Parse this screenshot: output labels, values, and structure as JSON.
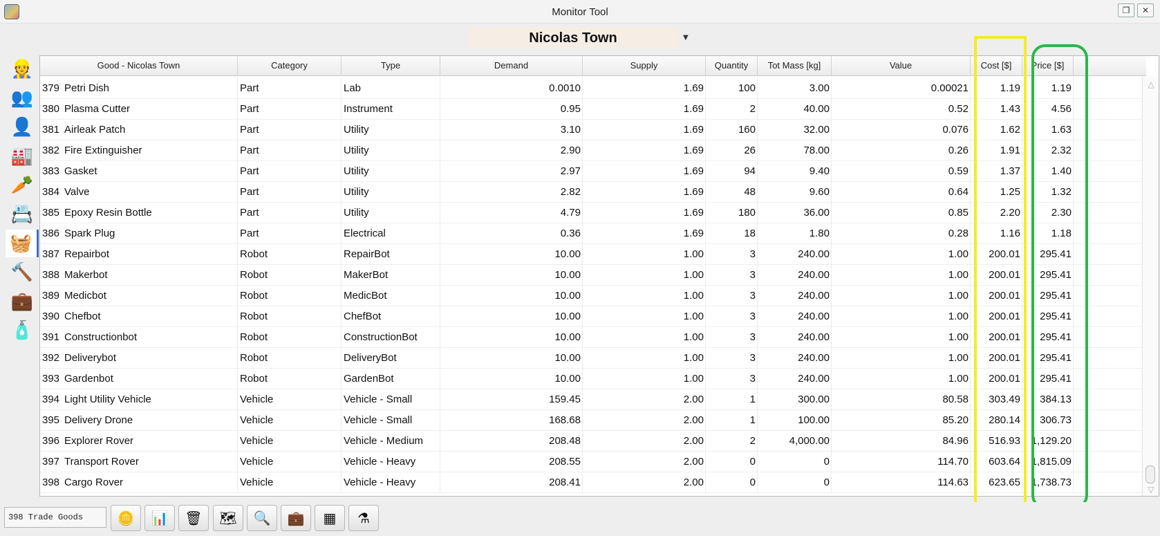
{
  "window": {
    "title": "Monitor Tool",
    "restore_glyph": "❐",
    "close_glyph": "✕"
  },
  "settlement": {
    "name": "Nicolas Town",
    "arrow": "▼"
  },
  "sidebar": {
    "items": [
      {
        "icon": "👷",
        "name": "people-icon",
        "color": "#6b3b14"
      },
      {
        "icon": "👥",
        "name": "crew-icon",
        "color": "#c03030"
      },
      {
        "icon": "👤",
        "name": "person-icon",
        "color": "#8e9aa3"
      },
      {
        "icon": "🏭",
        "name": "factory-icon",
        "color": "#0f7a4a"
      },
      {
        "icon": "🥕",
        "name": "food-icon",
        "color": "#ee6a1a"
      },
      {
        "icon": "📇",
        "name": "resource-icon",
        "color": "#555555"
      },
      {
        "icon": "🧺",
        "name": "trade-basket-icon",
        "color": "#2f9a28"
      },
      {
        "icon": "🔨",
        "name": "construction-icon",
        "color": "#3b7fc0"
      },
      {
        "icon": "💼",
        "name": "mission-briefcase-icon",
        "color": "#a0521d"
      },
      {
        "icon": "🧴",
        "name": "science-icon",
        "color": "#333333"
      }
    ]
  },
  "table": {
    "columns": [
      "Good - Nicolas Town",
      "Category",
      "Type",
      "Demand",
      "Supply",
      "Quantity",
      "Tot Mass [kg]",
      "Value",
      "Cost [$]",
      "Price [$]"
    ],
    "rows": [
      [
        "379",
        "Petri Dish",
        "Part",
        "Lab",
        "0.0010",
        "1.69",
        "100",
        "3.00",
        "0.00021",
        "1.19",
        "1.19"
      ],
      [
        "380",
        "Plasma Cutter",
        "Part",
        "Instrument",
        "0.95",
        "1.69",
        "2",
        "40.00",
        "0.52",
        "1.43",
        "4.56"
      ],
      [
        "381",
        "Airleak Patch",
        "Part",
        "Utility",
        "3.10",
        "1.69",
        "160",
        "32.00",
        "0.076",
        "1.62",
        "1.63"
      ],
      [
        "382",
        "Fire Extinguisher",
        "Part",
        "Utility",
        "2.90",
        "1.69",
        "26",
        "78.00",
        "0.26",
        "1.91",
        "2.32"
      ],
      [
        "383",
        "Gasket",
        "Part",
        "Utility",
        "2.97",
        "1.69",
        "94",
        "9.40",
        "0.59",
        "1.37",
        "1.40"
      ],
      [
        "384",
        "Valve",
        "Part",
        "Utility",
        "2.82",
        "1.69",
        "48",
        "9.60",
        "0.64",
        "1.25",
        "1.32"
      ],
      [
        "385",
        "Epoxy Resin Bottle",
        "Part",
        "Utility",
        "4.79",
        "1.69",
        "180",
        "36.00",
        "0.85",
        "2.20",
        "2.30"
      ],
      [
        "386",
        "Spark Plug",
        "Part",
        "Electrical",
        "0.36",
        "1.69",
        "18",
        "1.80",
        "0.28",
        "1.16",
        "1.18"
      ],
      [
        "387",
        "Repairbot",
        "Robot",
        "RepairBot",
        "10.00",
        "1.00",
        "3",
        "240.00",
        "1.00",
        "200.01",
        "295.41"
      ],
      [
        "388",
        "Makerbot",
        "Robot",
        "MakerBot",
        "10.00",
        "1.00",
        "3",
        "240.00",
        "1.00",
        "200.01",
        "295.41"
      ],
      [
        "389",
        "Medicbot",
        "Robot",
        "MedicBot",
        "10.00",
        "1.00",
        "3",
        "240.00",
        "1.00",
        "200.01",
        "295.41"
      ],
      [
        "390",
        "Chefbot",
        "Robot",
        "ChefBot",
        "10.00",
        "1.00",
        "3",
        "240.00",
        "1.00",
        "200.01",
        "295.41"
      ],
      [
        "391",
        "Constructionbot",
        "Robot",
        "ConstructionBot",
        "10.00",
        "1.00",
        "3",
        "240.00",
        "1.00",
        "200.01",
        "295.41"
      ],
      [
        "392",
        "Deliverybot",
        "Robot",
        "DeliveryBot",
        "10.00",
        "1.00",
        "3",
        "240.00",
        "1.00",
        "200.01",
        "295.41"
      ],
      [
        "393",
        "Gardenbot",
        "Robot",
        "GardenBot",
        "10.00",
        "1.00",
        "3",
        "240.00",
        "1.00",
        "200.01",
        "295.41"
      ],
      [
        "394",
        "Light Utility Vehicle",
        "Vehicle",
        "Vehicle - Small",
        "159.45",
        "2.00",
        "1",
        "300.00",
        "80.58",
        "303.49",
        "384.13"
      ],
      [
        "395",
        "Delivery Drone",
        "Vehicle",
        "Vehicle - Small",
        "168.68",
        "2.00",
        "1",
        "100.00",
        "85.20",
        "280.14",
        "306.73"
      ],
      [
        "396",
        "Explorer Rover",
        "Vehicle",
        "Vehicle - Medium",
        "208.48",
        "2.00",
        "2",
        "4,000.00",
        "84.96",
        "516.93",
        "1,129.20"
      ],
      [
        "397",
        "Transport Rover",
        "Vehicle",
        "Vehicle - Heavy",
        "208.55",
        "2.00",
        "0",
        "0",
        "114.70",
        "603.64",
        "1,815.09"
      ],
      [
        "398",
        "Cargo Rover",
        "Vehicle",
        "Vehicle - Heavy",
        "208.41",
        "2.00",
        "0",
        "0",
        "114.63",
        "623.65",
        "1,738.73"
      ]
    ]
  },
  "highlights": {
    "cost_color": "#f5ec21",
    "price_color": "#2bb64a"
  },
  "status": {
    "count_text": "398 Trade Goods"
  },
  "toolbar": {
    "buttons": [
      {
        "icon": "🪙",
        "name": "coins-icon"
      },
      {
        "icon": "📊",
        "name": "bar-chart-icon"
      },
      {
        "icon": "🗑",
        "name": "trash-icon"
      },
      {
        "icon": "🗺",
        "name": "map-icon"
      },
      {
        "icon": "🔍",
        "name": "search-icon"
      },
      {
        "icon": "💼",
        "name": "briefcase-icon"
      },
      {
        "icon": "▦",
        "name": "table-icon"
      },
      {
        "icon": "⚗",
        "name": "filter-icon"
      }
    ]
  }
}
